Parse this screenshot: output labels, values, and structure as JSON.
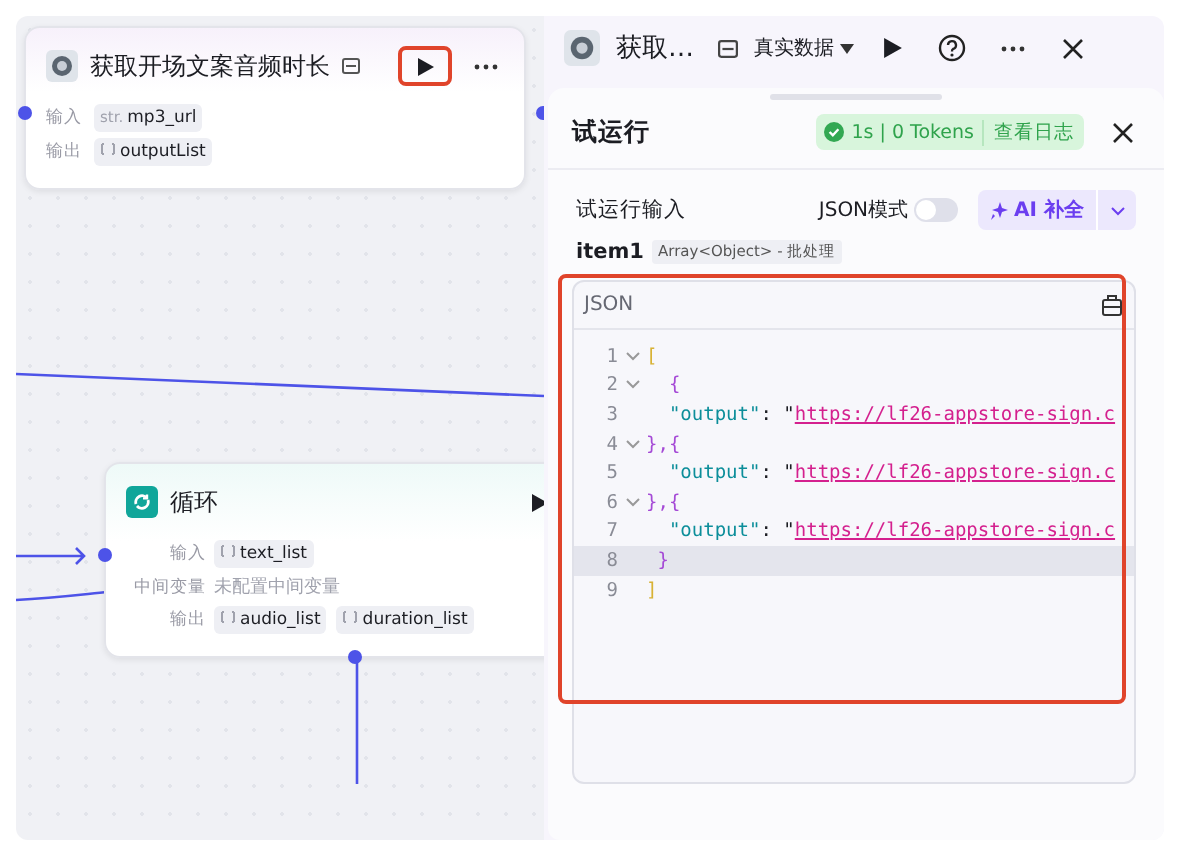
{
  "canvas": {
    "nodes": [
      {
        "kind": "tool",
        "title": "获取开场文案音频时长",
        "run_highlighted": true,
        "rows": [
          {
            "label": "输入",
            "tags": [
              {
                "kind": "string",
                "type": "str.",
                "name": "mp3_url"
              }
            ]
          },
          {
            "label": "输出",
            "tags": [
              {
                "kind": "list",
                "name": "outputList"
              }
            ]
          }
        ]
      },
      {
        "kind": "loop",
        "title": "循环",
        "run_highlighted": false,
        "rows": [
          {
            "label": "输入",
            "tags": [
              {
                "kind": "list",
                "name": "text_list"
              }
            ]
          },
          {
            "label": "中间变量",
            "note": "未配置中间变量"
          },
          {
            "label": "输出",
            "tags": [
              {
                "kind": "list",
                "name": "audio_list"
              },
              {
                "kind": "list",
                "name": "duration_list"
              }
            ]
          }
        ]
      }
    ]
  },
  "panel": {
    "title": "获取…",
    "data_source": "真实数据",
    "test_run": {
      "title": "试运行",
      "status": {
        "stats": "1s | 0 Tokens",
        "log_link": "查看日志"
      },
      "input_label": "试运行输入",
      "json_mode": {
        "label": "JSON模式",
        "on": false
      },
      "ai_button": "AI 补全",
      "param": {
        "name": "item1",
        "type": "Array<Object> - 批处理"
      },
      "editor": {
        "title": "JSON",
        "highlighted": true,
        "lines": [
          {
            "number": "1",
            "foldable": true,
            "active": false,
            "segments": [
              {
                "kind": "bracket",
                "text": "["
              }
            ]
          },
          {
            "number": "2",
            "foldable": true,
            "active": false,
            "segments": [
              {
                "kind": "brace",
                "text": "  {"
              }
            ]
          },
          {
            "number": "3",
            "foldable": false,
            "active": false,
            "segments": [
              {
                "kind": "key",
                "text": "  \"output\""
              },
              {
                "kind": "punct",
                "text": ": \""
              },
              {
                "kind": "link",
                "text": "https://lf26-appstore-sign.c"
              }
            ]
          },
          {
            "number": "4",
            "foldable": true,
            "active": false,
            "segments": [
              {
                "kind": "brace",
                "text": "},{"
              }
            ]
          },
          {
            "number": "5",
            "foldable": false,
            "active": false,
            "segments": [
              {
                "kind": "key",
                "text": "  \"output\""
              },
              {
                "kind": "punct",
                "text": ": \""
              },
              {
                "kind": "link",
                "text": "https://lf26-appstore-sign.c"
              }
            ]
          },
          {
            "number": "6",
            "foldable": true,
            "active": false,
            "segments": [
              {
                "kind": "brace",
                "text": "},{"
              }
            ]
          },
          {
            "number": "7",
            "foldable": false,
            "active": false,
            "segments": [
              {
                "kind": "key",
                "text": "  \"output\""
              },
              {
                "kind": "punct",
                "text": ": \""
              },
              {
                "kind": "link",
                "text": "https://lf26-appstore-sign.c"
              }
            ]
          },
          {
            "number": "8",
            "foldable": false,
            "active": true,
            "segments": [
              {
                "kind": "brace",
                "text": " }"
              }
            ]
          },
          {
            "number": "9",
            "foldable": false,
            "active": false,
            "segments": [
              {
                "kind": "bracket",
                "text": "]"
              }
            ]
          }
        ]
      }
    }
  }
}
